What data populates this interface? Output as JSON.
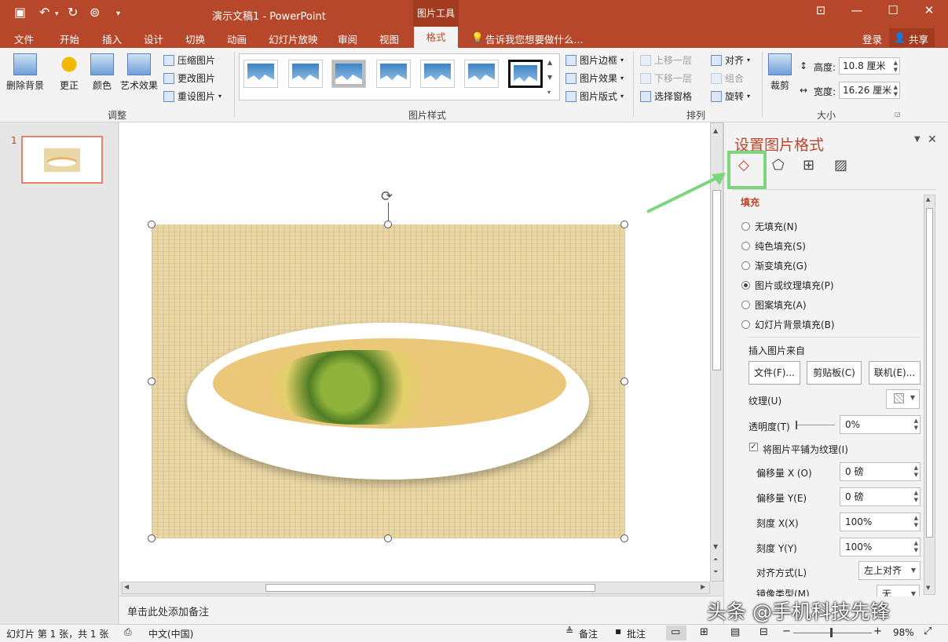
{
  "window": {
    "title": "演示文稿1 - PowerPoint",
    "context_tab": "图片工具",
    "login": "登录",
    "share": "共享",
    "accent": "#b7472a"
  },
  "tabs": [
    "文件",
    "开始",
    "插入",
    "设计",
    "切换",
    "动画",
    "幻灯片放映",
    "审阅",
    "视图",
    "格式"
  ],
  "active_tab": "格式",
  "tell_me": "告诉我您想要做什么...",
  "ribbon": {
    "adjust": {
      "remove_bg": "删除背景",
      "corrections": "更正",
      "color": "颜色",
      "artistic": "艺术效果",
      "compress": "压缩图片",
      "change": "更改图片",
      "reset": "重设图片",
      "group": "调整"
    },
    "styles": {
      "border": "图片边框",
      "effects": "图片效果",
      "layout": "图片版式",
      "group": "图片样式"
    },
    "arrange": {
      "bring_forward": "上移一层",
      "send_backward": "下移一层",
      "selection_pane": "选择窗格",
      "align": "对齐",
      "group_btn": "组合",
      "rotate": "旋转",
      "group": "排列"
    },
    "size": {
      "crop": "裁剪",
      "height_label": "高度:",
      "height": "10.8 厘米",
      "width_label": "宽度:",
      "width": "16.26 厘米",
      "group": "大小"
    }
  },
  "thumbs": {
    "number": "1"
  },
  "notes_placeholder": "单击此处添加备注",
  "status": {
    "slide_info": "幻灯片 第 1 张，共 1 张",
    "language": "中文(中国)",
    "notes": "备注",
    "comments": "批注",
    "zoom": "98%"
  },
  "format_pane": {
    "title": "设置图片格式",
    "section": "填充",
    "options": [
      {
        "label": "无填充(N)",
        "selected": false
      },
      {
        "label": "纯色填充(S)",
        "selected": false
      },
      {
        "label": "渐变填充(G)",
        "selected": false
      },
      {
        "label": "图片或纹理填充(P)",
        "selected": true
      },
      {
        "label": "图案填充(A)",
        "selected": false
      },
      {
        "label": "幻灯片背景填充(B)",
        "selected": false
      }
    ],
    "insert_from": "插入图片来自",
    "file_btn": "文件(F)...",
    "clipboard_btn": "剪贴板(C)",
    "online_btn": "联机(E)...",
    "texture_label": "纹理(U)",
    "transparency_label": "透明度(T)",
    "transparency": "0%",
    "tile_label": "将图片平铺为纹理(I)",
    "offset_x_label": "偏移量 X (O)",
    "offset_x": "0 磅",
    "offset_y_label": "偏移量 Y(E)",
    "offset_y": "0 磅",
    "scale_x_label": "刻度 X(X)",
    "scale_x": "100%",
    "scale_y_label": "刻度 Y(Y)",
    "scale_y": "100%",
    "align_label": "对齐方式(L)",
    "align": "左上对齐",
    "mirror_label": "镜像类型(M)",
    "mirror": "无"
  },
  "watermark": "头条 @手机科技先锋"
}
